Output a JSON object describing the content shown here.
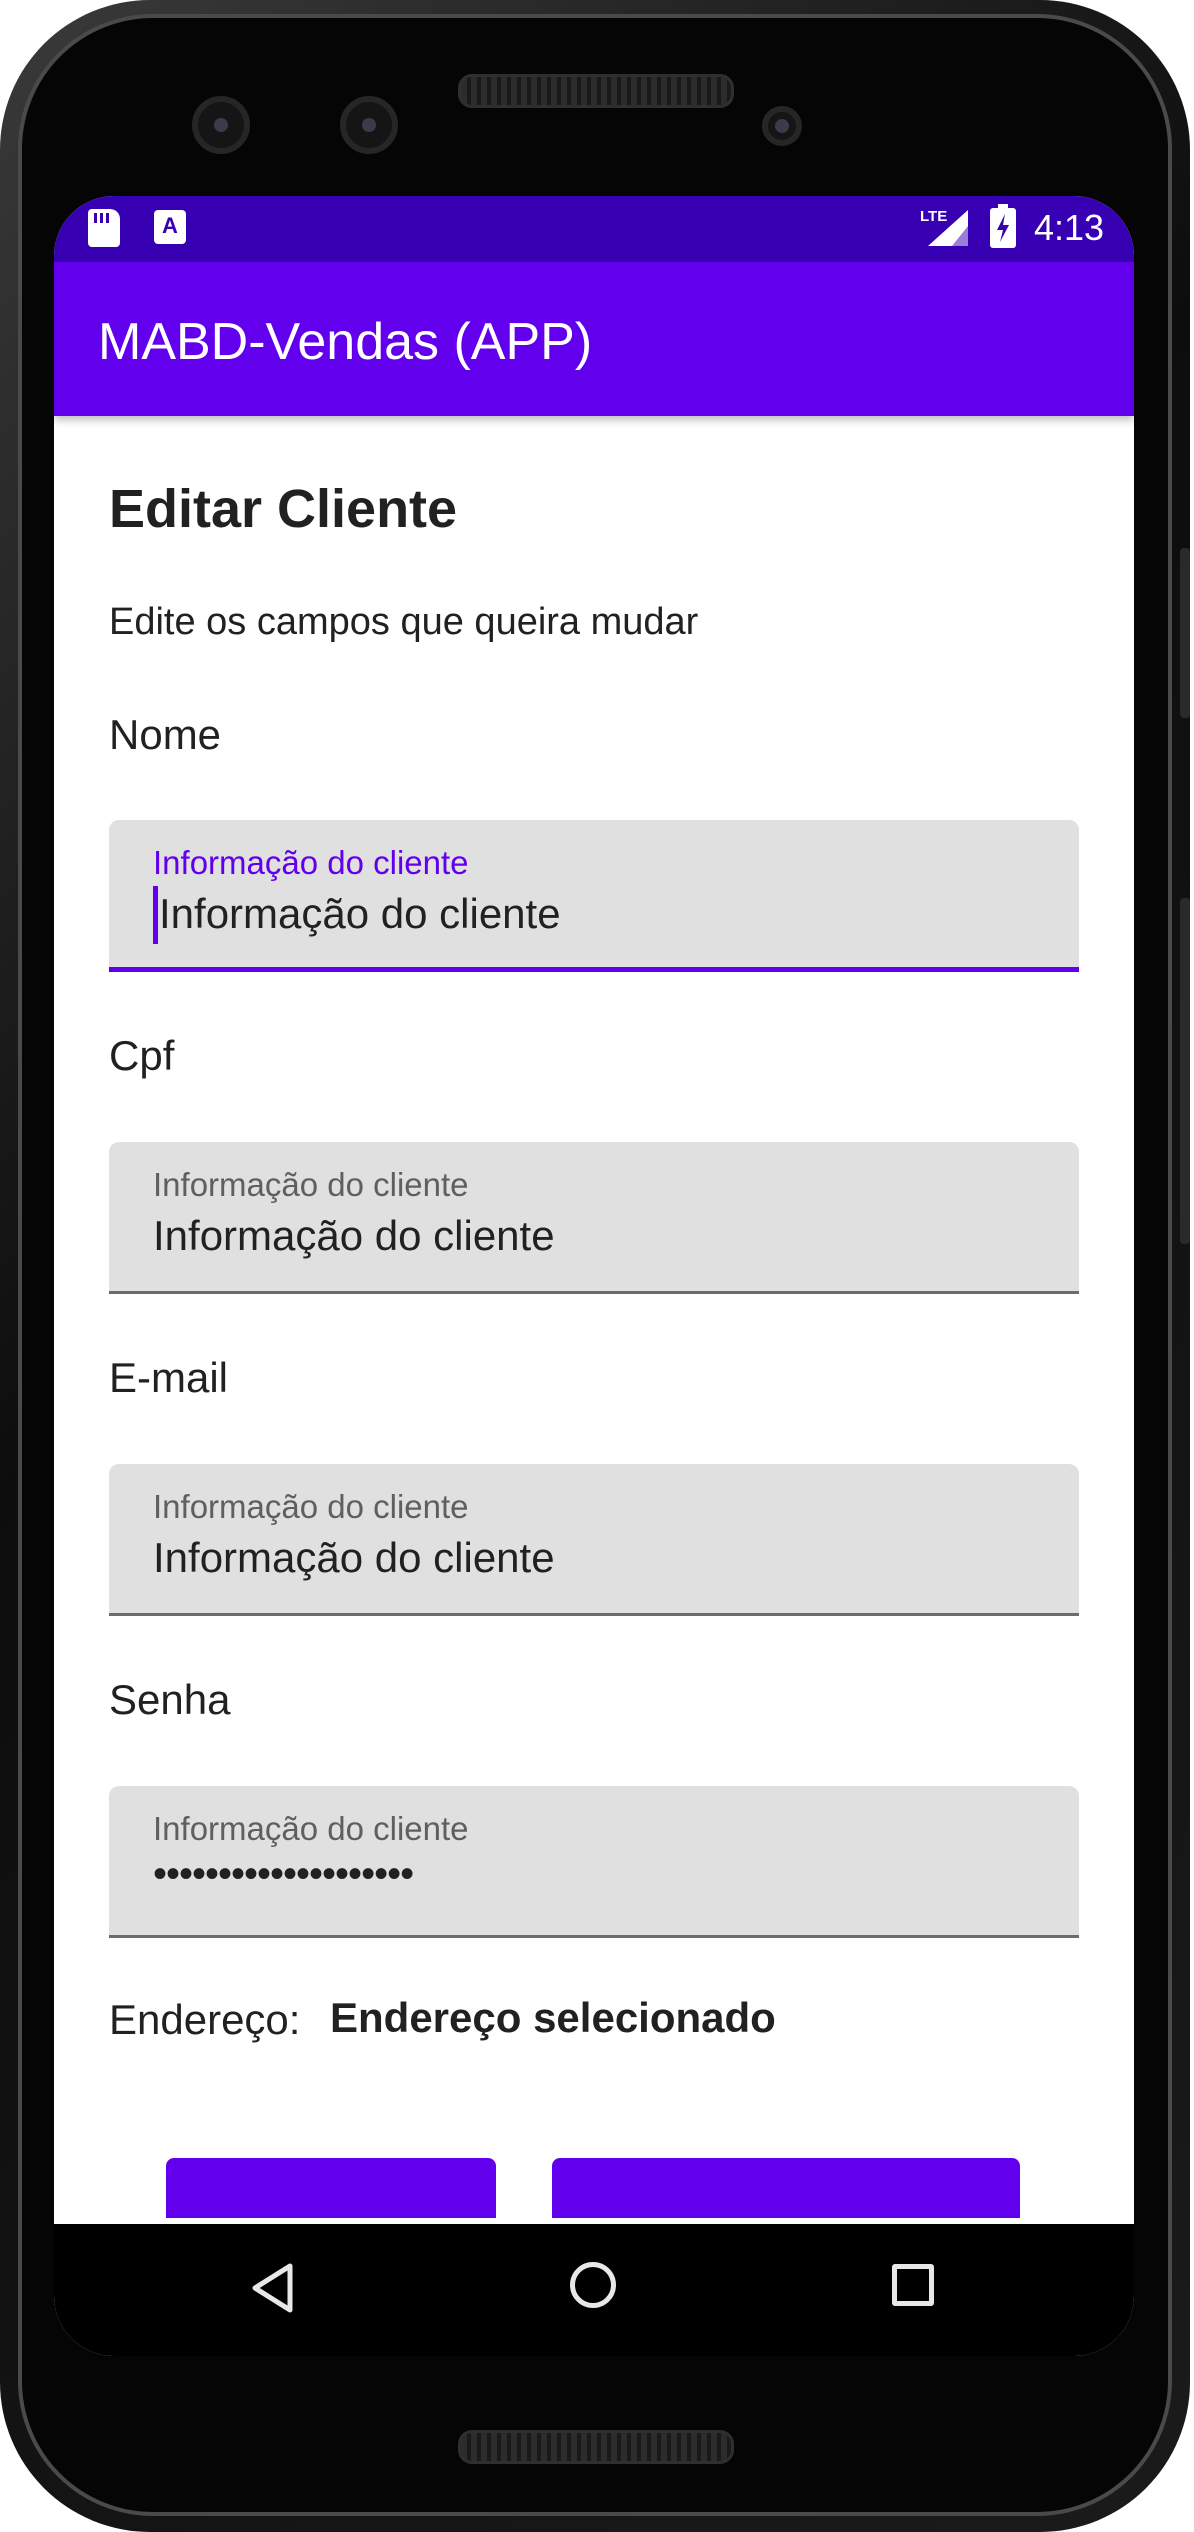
{
  "status_bar": {
    "time": "4:13",
    "network_label": "LTE",
    "icons": [
      "sd-card-icon",
      "keyboard-a-icon",
      "lte-signal-icon",
      "battery-charging-icon"
    ]
  },
  "app_bar": {
    "title": "MABD-Vendas (APP)"
  },
  "page": {
    "title": "Editar Cliente",
    "subtitle": "Edite os campos que queira mudar"
  },
  "fields": [
    {
      "label": "Nome",
      "hint": "Informação do cliente",
      "value": "Informação do cliente",
      "focused": true
    },
    {
      "label": "Cpf",
      "hint": "Informação do cliente",
      "value": "Informação do cliente",
      "focused": false
    },
    {
      "label": "E-mail",
      "hint": "Informação do cliente",
      "value": "Informação do cliente",
      "focused": false
    },
    {
      "label": "Senha",
      "hint": "Informação do cliente",
      "value": "••••••••••••••••••••",
      "focused": false
    }
  ],
  "address": {
    "label": "Endereço:",
    "value": "Endereço selecionado"
  },
  "colors": {
    "primary": "#6200ee",
    "primary_dark": "#3700b3",
    "field_bg": "#e0e0e0"
  }
}
